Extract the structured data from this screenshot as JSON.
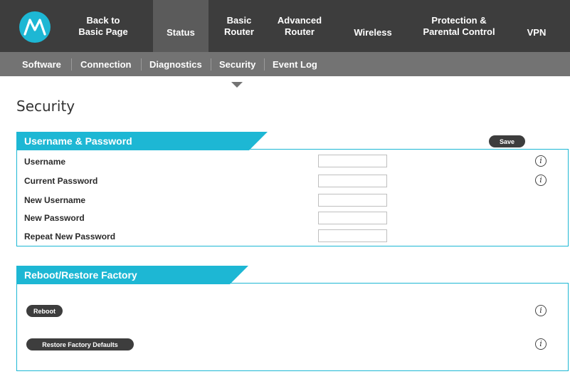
{
  "brand": {
    "logo_icon": "motorola-batwing-logo",
    "accent": "#1db7d4"
  },
  "topnav": {
    "items": [
      {
        "id": "back",
        "label": "Back to\nBasic Page"
      },
      {
        "id": "status",
        "label": "Status",
        "active": true
      },
      {
        "id": "basic-router",
        "label": "Basic\nRouter"
      },
      {
        "id": "advanced-router",
        "label": "Advanced\nRouter"
      },
      {
        "id": "wireless",
        "label": "Wireless"
      },
      {
        "id": "protection",
        "label": "Protection &\nParental Control"
      },
      {
        "id": "vpn",
        "label": "VPN"
      }
    ]
  },
  "subnav": {
    "items": [
      {
        "id": "software",
        "label": "Software"
      },
      {
        "id": "connection",
        "label": "Connection"
      },
      {
        "id": "diagnostics",
        "label": "Diagnostics"
      },
      {
        "id": "security",
        "label": "Security",
        "active": true
      },
      {
        "id": "event-log",
        "label": "Event Log"
      }
    ]
  },
  "page": {
    "title": "Security"
  },
  "credentials": {
    "header": "Username & Password",
    "save_label": "Save",
    "fields": [
      {
        "label": "Username",
        "value": "",
        "info": true
      },
      {
        "label": "Current Password",
        "value": "",
        "info": true
      },
      {
        "label": "New Username",
        "value": "",
        "info": false
      },
      {
        "label": "New Password",
        "value": "",
        "info": false
      },
      {
        "label": "Repeat New Password",
        "value": "",
        "info": false
      }
    ]
  },
  "reboot": {
    "header": "Reboot/Restore Factory",
    "reboot_label": "Reboot",
    "restore_label": "Restore Factory Defaults"
  },
  "icons": {
    "info": "info-icon",
    "info_glyph": "i"
  }
}
